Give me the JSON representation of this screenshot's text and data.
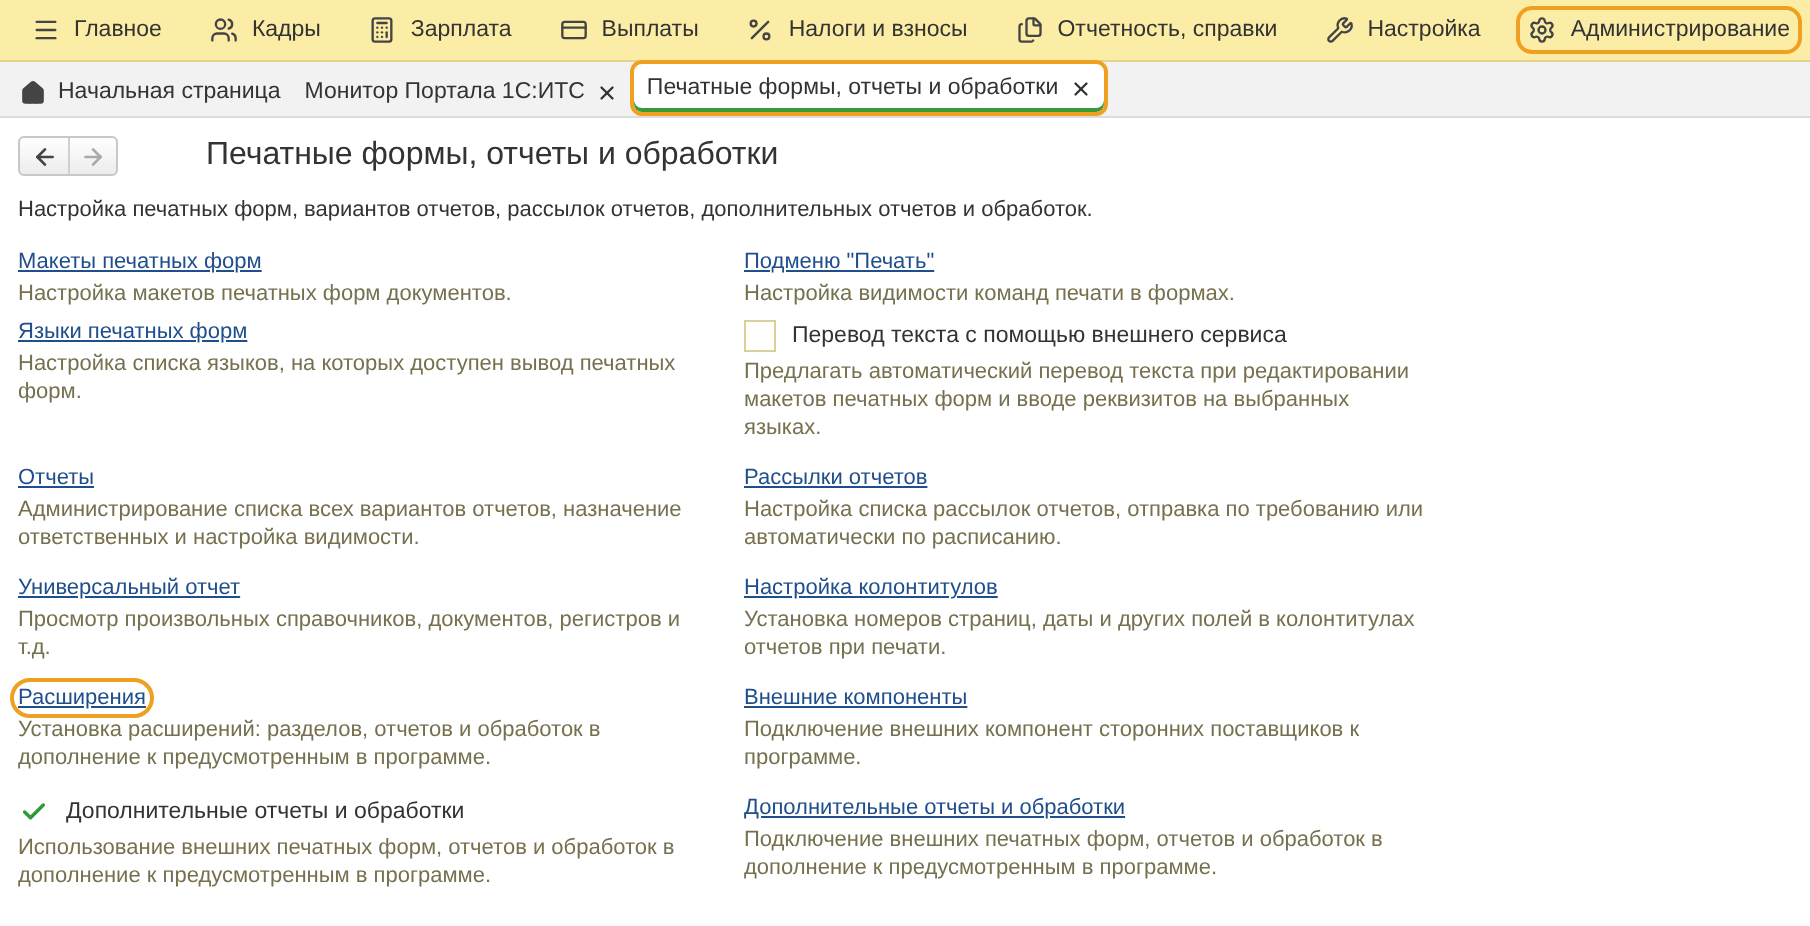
{
  "menu": [
    {
      "label": "Главное",
      "highlighted": false
    },
    {
      "label": "Кадры",
      "highlighted": false
    },
    {
      "label": "Зарплата",
      "highlighted": false
    },
    {
      "label": "Выплаты",
      "highlighted": false
    },
    {
      "label": "Налоги и взносы",
      "highlighted": false
    },
    {
      "label": "Отчетность, справки",
      "highlighted": false
    },
    {
      "label": "Настройка",
      "highlighted": false
    },
    {
      "label": "Администрирование",
      "highlighted": true
    }
  ],
  "tabs": [
    {
      "kind": "home",
      "label": "Начальная страница",
      "selected": false,
      "highlighted": false
    },
    {
      "kind": "page",
      "label": "Монитор Портала 1С:ИТС",
      "selected": false,
      "highlighted": false
    },
    {
      "kind": "page",
      "label": "Печатные формы, отчеты и обработки",
      "selected": true,
      "highlighted": true
    }
  ],
  "page": {
    "title": "Печатные формы, отчеты и обработки",
    "description": "Настройка печатных форм, вариантов отчетов, рассылок отчетов, дополнительных отчетов и обработок."
  },
  "rows": [
    {
      "left": [
        {
          "kind": "link",
          "label": "Макеты печатных форм",
          "description": "Настройка макетов печатных форм документов.",
          "highlighted": false
        },
        {
          "kind": "link",
          "label": "Языки печатных форм",
          "description": "Настройка списка языков, на которых доступен вывод печатных форм.",
          "highlighted": false
        }
      ],
      "right": [
        {
          "kind": "link",
          "label": "Подменю \"Печать\"",
          "description": "Настройка видимости команд печати в формах.",
          "highlighted": false
        },
        {
          "kind": "checkbox",
          "label": "Перевод текста с помощью внешнего сервиса",
          "checked": false,
          "description": "Предлагать автоматический перевод текста при редактировании макетов печатных форм и вводе реквизитов на выбранных языках."
        }
      ]
    },
    {
      "left": [
        {
          "kind": "link",
          "label": "Отчеты",
          "description": "Администрирование списка всех вариантов отчетов, назначение ответственных и настройка видимости.",
          "highlighted": false
        }
      ],
      "right": [
        {
          "kind": "link",
          "label": "Рассылки отчетов",
          "description": "Настройка списка рассылок отчетов, отправка по требованию или автоматически по расписанию.",
          "highlighted": false
        }
      ]
    },
    {
      "left": [
        {
          "kind": "link",
          "label": "Универсальный отчет",
          "description": "Просмотр произвольных справочников, документов, регистров и т.д.",
          "highlighted": false
        }
      ],
      "right": [
        {
          "kind": "link",
          "label": "Настройка колонтитулов",
          "description": "Установка номеров страниц, даты и других полей в колонтитулах отчетов при печати.",
          "highlighted": false
        }
      ]
    },
    {
      "left": [
        {
          "kind": "link",
          "label": "Расширения",
          "description": "Установка расширений: разделов, отчетов и обработок в дополнение к предусмотренным в программе.",
          "highlighted": true
        }
      ],
      "right": [
        {
          "kind": "link",
          "label": "Внешние компоненты",
          "description": "Подключение внешних компонент сторонних поставщиков к программе.",
          "highlighted": false
        }
      ]
    },
    {
      "left": [
        {
          "kind": "checkbox",
          "label": "Дополнительные отчеты и обработки",
          "checked": true,
          "description": "Использование внешних печатных форм, отчетов и обработок в дополнение к предусмотренным в программе."
        }
      ],
      "right": [
        {
          "kind": "link",
          "label": "Дополнительные отчеты и обработки",
          "description": "Подключение внешних печатных форм, отчетов и обработок в дополнение к предусмотренным в программе.",
          "highlighted": false
        }
      ]
    }
  ]
}
